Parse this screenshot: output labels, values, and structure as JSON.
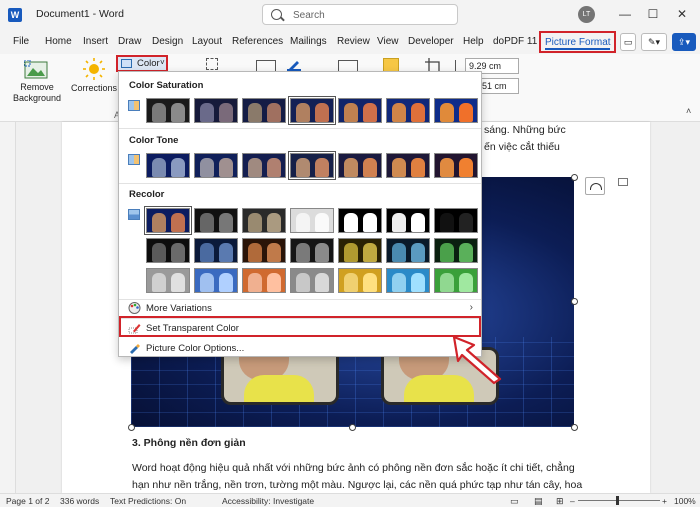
{
  "titlebar": {
    "doc_title": "Document1  -  Word",
    "search_placeholder": "Search",
    "avatar_initials": "LT",
    "minimize": "—",
    "maximize": "☐",
    "close": "✕"
  },
  "tabs": [
    "File",
    "Home",
    "Insert",
    "Draw",
    "Design",
    "Layout",
    "References",
    "Mailings",
    "Review",
    "View",
    "Developer",
    "Help",
    "doPDF 11"
  ],
  "active_tab": "Picture Format",
  "ribbon": {
    "remove_background": "Remove\nBackground",
    "corrections": "Corrections",
    "color_button": "Color",
    "height_value": "9.29 cm",
    "width_value": "51 cm"
  },
  "dropdown": {
    "color_saturation": "Color Saturation",
    "color_tone": "Color Tone",
    "recolor": "Recolor",
    "more_variations": "More Variations",
    "set_transparent_color": "Set Transparent Color",
    "picture_color_options": "Picture Color Options..."
  },
  "document": {
    "line1_tail": "sáng. Những bức",
    "line2_tail": "ến việc cắt thiếu",
    "heading": "3. Phông nền đơn giản",
    "para1": "Word hoạt động hiệu quả nhất với những bức ảnh có phông nền đơn sắc hoặc ít chi tiết, chẳng",
    "para2": "hạn như nền trắng, nền trơn, tường một màu. Ngược lại, các nền quá phức tạp như tán cây, hoa"
  },
  "statusbar": {
    "page": "Page 1 of 2",
    "words": "336 words",
    "text_predictions": "Text Predictions: On",
    "accessibility": "Accessibility: Investigate",
    "zoom": "100%"
  },
  "colors": {
    "accent": "#185abd",
    "highlight": "#d1232a"
  }
}
